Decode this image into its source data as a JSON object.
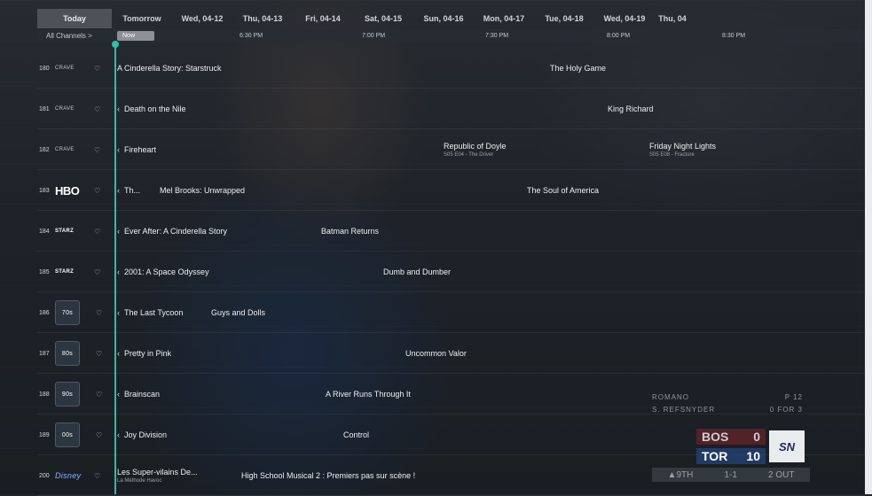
{
  "dates": [
    "Today",
    "Tomorrow",
    "Wed, 04-12",
    "Thu, 04-13",
    "Fri, 04-14",
    "Sat, 04-15",
    "Sun, 04-16",
    "Mon, 04-17",
    "Tue, 04-18",
    "Wed, 04-19",
    "Thu, 04"
  ],
  "timebar": {
    "all_channels": "All Channels  >",
    "now": "Now",
    "times": [
      "6:30 PM",
      "7:00 PM",
      "7:30 PM",
      "8:00 PM",
      "8:30 PM"
    ]
  },
  "channels": [
    {
      "num": "180",
      "logo": "CRAVE",
      "programs": [
        {
          "title": "A Cinderella Story: Starstruck"
        },
        {
          "title": "The Holy Game"
        }
      ]
    },
    {
      "num": "181",
      "logo": "CRAVE",
      "programs": [
        {
          "title": "Death on the Nile"
        },
        {
          "title": "King Richard"
        }
      ]
    },
    {
      "num": "182",
      "logo": "CRAVE",
      "programs": [
        {
          "title": "Fireheart"
        },
        {
          "title": "Republic of Doyle",
          "sub": "S05 E04 - The Driver"
        },
        {
          "title": "Friday Night Lights",
          "sub": "S05 E08 - Fracture"
        }
      ]
    },
    {
      "num": "183",
      "logo": "HBO",
      "programs": [
        {
          "title": "Th..."
        },
        {
          "title": "Mel Brooks: Unwrapped"
        },
        {
          "title": "The Soul of America"
        }
      ]
    },
    {
      "num": "184",
      "logo": "STARZ",
      "programs": [
        {
          "title": "Ever After: A Cinderella Story"
        },
        {
          "title": "Batman Returns"
        }
      ]
    },
    {
      "num": "185",
      "logo": "STARZ",
      "programs": [
        {
          "title": "2001: A Space Odyssey"
        },
        {
          "title": "Dumb and Dumber"
        }
      ]
    },
    {
      "num": "186",
      "logo": "70s",
      "programs": [
        {
          "title": "The Last Tycoon"
        },
        {
          "title": "Guys and Dolls"
        }
      ]
    },
    {
      "num": "187",
      "logo": "80s",
      "programs": [
        {
          "title": "Pretty in Pink"
        },
        {
          "title": "Uncommon Valor"
        }
      ]
    },
    {
      "num": "188",
      "logo": "90s",
      "programs": [
        {
          "title": "Brainscan"
        },
        {
          "title": "A River Runs Through It"
        }
      ]
    },
    {
      "num": "189",
      "logo": "00s",
      "programs": [
        {
          "title": "Joy Division"
        },
        {
          "title": "Control"
        }
      ]
    },
    {
      "num": "200",
      "logo": "Disney",
      "programs": [
        {
          "title": "Les Super-vilains De...",
          "sub": "La Méthode Havoc"
        },
        {
          "title": "High School Musical 2 : Premiers pas sur scène !"
        }
      ]
    }
  ],
  "scoreboard": {
    "line1_name": "ROMANO",
    "line1_stat": "P 12",
    "line2_name": "S. REFSNYDER",
    "line2_stat": "0 FOR 3",
    "away": "BOS",
    "away_score": "0",
    "home": "TOR",
    "home_score": "10",
    "network": "SN",
    "inning": "▲9TH",
    "count": "1-1",
    "outs": "2 OUT"
  },
  "colors": {
    "now_line": "#2fbfa4",
    "tor": "#2a5ab4",
    "bos": "#be2828"
  }
}
